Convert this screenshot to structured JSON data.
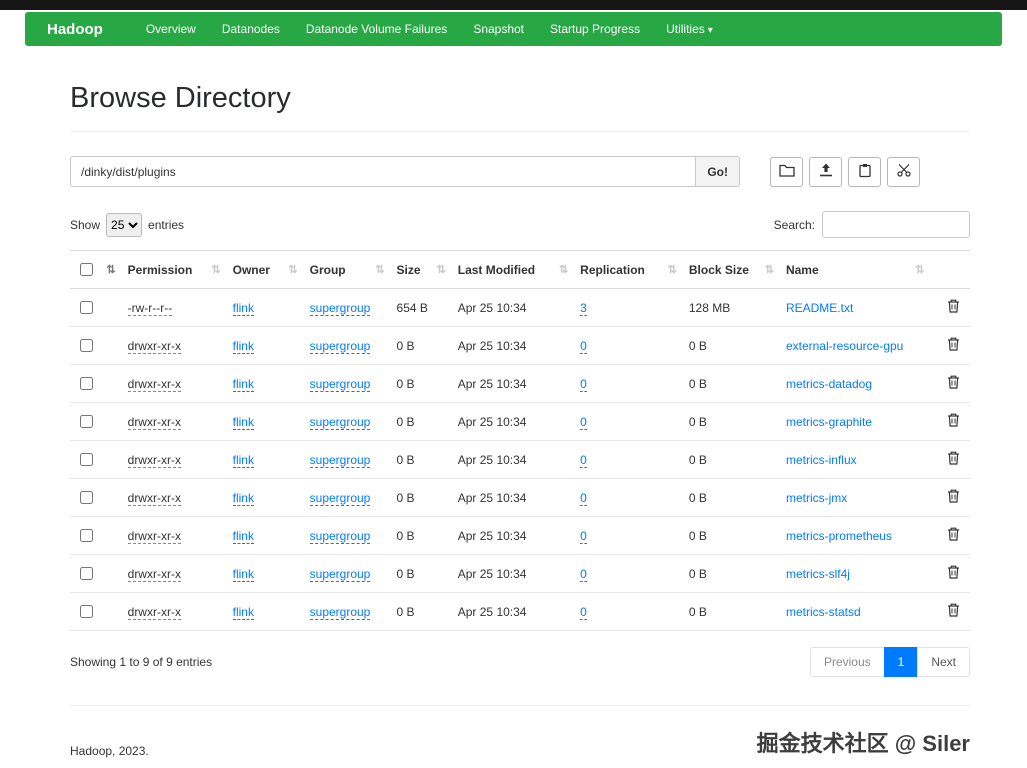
{
  "colors": {
    "navbar_green": "#28a745",
    "link_blue": "#007bff",
    "active_page_bg": "#007bff"
  },
  "navbar": {
    "brand": "Hadoop",
    "items": [
      {
        "label": "Overview",
        "dropdown": false
      },
      {
        "label": "Datanodes",
        "dropdown": false
      },
      {
        "label": "Datanode Volume Failures",
        "dropdown": false
      },
      {
        "label": "Snapshot",
        "dropdown": false
      },
      {
        "label": "Startup Progress",
        "dropdown": false
      },
      {
        "label": "Utilities",
        "dropdown": true
      }
    ]
  },
  "page": {
    "title": "Browse Directory",
    "path_value": "/dinky/dist/plugins",
    "go_label": "Go!",
    "show_label": "Show",
    "page_size": "25",
    "entries_label": "entries",
    "search_label": "Search:",
    "showing_text": "Showing 1 to 9 of 9 entries",
    "pagination": {
      "previous": "Previous",
      "page": "1",
      "next": "Next"
    },
    "footer": "Hadoop, 2023.",
    "watermark": "掘金技术社区 @ Siler"
  },
  "toolbar_icons": [
    "folder-icon",
    "upload-icon",
    "clipboard-icon",
    "scissors-icon"
  ],
  "table": {
    "headers": [
      "Permission",
      "Owner",
      "Group",
      "Size",
      "Last Modified",
      "Replication",
      "Block Size",
      "Name"
    ],
    "rows": [
      {
        "permission": "-rw-r--r--",
        "owner": "flink",
        "group": "supergroup",
        "size": "654 B",
        "modified": "Apr 25 10:34",
        "replication": "3",
        "block_size": "128 MB",
        "name": "README.txt"
      },
      {
        "permission": "drwxr-xr-x",
        "owner": "flink",
        "group": "supergroup",
        "size": "0 B",
        "modified": "Apr 25 10:34",
        "replication": "0",
        "block_size": "0 B",
        "name": "external-resource-gpu"
      },
      {
        "permission": "drwxr-xr-x",
        "owner": "flink",
        "group": "supergroup",
        "size": "0 B",
        "modified": "Apr 25 10:34",
        "replication": "0",
        "block_size": "0 B",
        "name": "metrics-datadog"
      },
      {
        "permission": "drwxr-xr-x",
        "owner": "flink",
        "group": "supergroup",
        "size": "0 B",
        "modified": "Apr 25 10:34",
        "replication": "0",
        "block_size": "0 B",
        "name": "metrics-graphite"
      },
      {
        "permission": "drwxr-xr-x",
        "owner": "flink",
        "group": "supergroup",
        "size": "0 B",
        "modified": "Apr 25 10:34",
        "replication": "0",
        "block_size": "0 B",
        "name": "metrics-influx"
      },
      {
        "permission": "drwxr-xr-x",
        "owner": "flink",
        "group": "supergroup",
        "size": "0 B",
        "modified": "Apr 25 10:34",
        "replication": "0",
        "block_size": "0 B",
        "name": "metrics-jmx"
      },
      {
        "permission": "drwxr-xr-x",
        "owner": "flink",
        "group": "supergroup",
        "size": "0 B",
        "modified": "Apr 25 10:34",
        "replication": "0",
        "block_size": "0 B",
        "name": "metrics-prometheus"
      },
      {
        "permission": "drwxr-xr-x",
        "owner": "flink",
        "group": "supergroup",
        "size": "0 B",
        "modified": "Apr 25 10:34",
        "replication": "0",
        "block_size": "0 B",
        "name": "metrics-slf4j"
      },
      {
        "permission": "drwxr-xr-x",
        "owner": "flink",
        "group": "supergroup",
        "size": "0 B",
        "modified": "Apr 25 10:34",
        "replication": "0",
        "block_size": "0 B",
        "name": "metrics-statsd"
      }
    ]
  }
}
